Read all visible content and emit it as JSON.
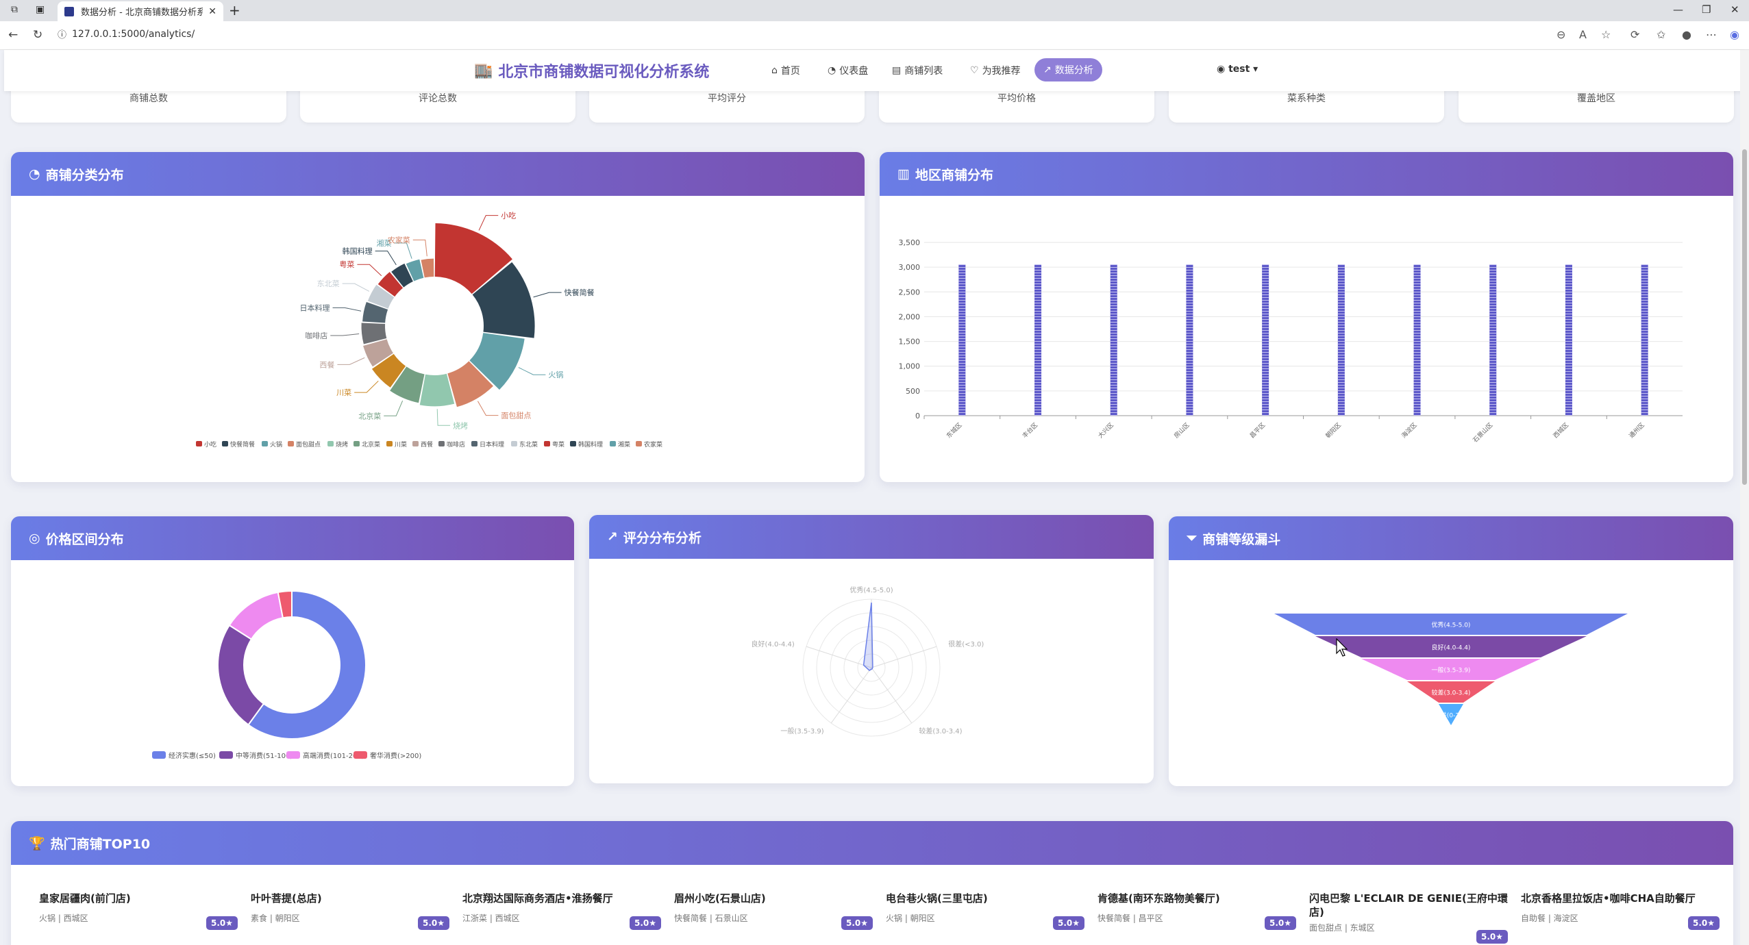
{
  "browser": {
    "tab_title": "数据分析 - 北京商铺数据分析系统",
    "url": "127.0.0.1:5000/analytics/"
  },
  "header": {
    "brand": "北京市商铺数据可视化分析系统",
    "nav": [
      "首页",
      "仪表盘",
      "商铺列表",
      "为我推荐",
      "数据分析"
    ],
    "user": "test"
  },
  "stats": [
    "商铺总数",
    "评论总数",
    "平均评分",
    "平均价格",
    "菜系种类",
    "覆盖地区"
  ],
  "panels": {
    "category": "商铺分类分布",
    "region": "地区商铺分布",
    "price": "价格区间分布",
    "rating": "评分分布分析",
    "funnel": "商铺等级漏斗",
    "top10": "热门商铺TOP10"
  },
  "chart_data": [
    {
      "type": "pie",
      "name": "category",
      "categories": [
        "小吃",
        "快餐简餐",
        "火锅",
        "面包甜点",
        "烧烤",
        "北京菜",
        "川菜",
        "西餐",
        "咖啡店",
        "日本料理",
        "东北菜",
        "粤菜",
        "韩国料理",
        "湘菜",
        "农家菜"
      ],
      "values": [
        100,
        95,
        75,
        60,
        52,
        48,
        42,
        38,
        36,
        34,
        32,
        30,
        28,
        26,
        24
      ],
      "colors": [
        "#c23531",
        "#2f4554",
        "#61a0a8",
        "#d48265",
        "#91c7ae",
        "#749f83",
        "#ca8622",
        "#bda29a",
        "#6e7074",
        "#546570",
        "#c4ccd3",
        "#c23531",
        "#2f4554",
        "#61a0a8",
        "#d48265"
      ]
    },
    {
      "type": "bar",
      "name": "region",
      "categories": [
        "东城区",
        "丰台区",
        "大兴区",
        "房山区",
        "昌平区",
        "朝阳区",
        "海淀区",
        "石景山区",
        "西城区",
        "通州区"
      ],
      "values": [
        3050,
        3050,
        3050,
        3050,
        3050,
        3050,
        3050,
        3050,
        3050,
        3050
      ],
      "ylim": [
        0,
        3500
      ],
      "yticks": [
        "0",
        "500",
        "1,000",
        "1,500",
        "2,000",
        "2,500",
        "3,000",
        "3,500"
      ]
    },
    {
      "type": "pie",
      "name": "price",
      "categories": [
        "经济实惠(≤50)",
        "中等消费(51-100)",
        "高端消费(101-200)",
        "奢华消费(>200)"
      ],
      "values": [
        60,
        24,
        13,
        3
      ],
      "colors": [
        "#6b80e8",
        "#7b4aa6",
        "#ee8af0",
        "#ee5a6e"
      ]
    },
    {
      "type": "radar",
      "name": "rating",
      "categories": [
        "优秀(4.5-5.0)",
        "很差(<3.0)",
        "较差(3.0-3.4)",
        "一般(3.5-3.9)",
        "良好(4.0-4.4)"
      ],
      "values": [
        0.95,
        0.02,
        0.02,
        0.05,
        0.12
      ]
    },
    {
      "type": "funnel",
      "name": "funnel",
      "categories": [
        "优秀(4.5-5.0)",
        "良好(4.0-4.4)",
        "一般(3.5-3.9)",
        "较差(3.0-3.4)",
        "很差(0-2.9)"
      ],
      "colors": [
        "#6b80e8",
        "#7b4aa6",
        "#ee8af0",
        "#ee5a6e",
        "#4facfe"
      ]
    }
  ],
  "top10": [
    {
      "name": "皇家居疆肉(前门店)",
      "meta": "火锅 | 西城区",
      "score": "5.0★"
    },
    {
      "name": "叶叶菩提(总店)",
      "meta": "素食 | 朝阳区",
      "score": "5.0★"
    },
    {
      "name": "北京翔达国际商务酒店•淮扬餐厅",
      "meta": "江浙菜 | 西城区",
      "score": "5.0★"
    },
    {
      "name": "眉州小吃(石景山店)",
      "meta": "快餐简餐 | 石景山区",
      "score": "5.0★"
    },
    {
      "name": "电台巷火锅(三里屯店)",
      "meta": "火锅 | 朝阳区",
      "score": "5.0★"
    },
    {
      "name": "肯德基(南环东路物美餐厅)",
      "meta": "快餐简餐 | 昌平区",
      "score": "5.0★"
    },
    {
      "name": "闪电巴黎 L'ECLAIR DE GENIE(王府中環店)",
      "meta": "面包甜点 | 东城区",
      "score": "5.0★"
    },
    {
      "name": "北京香格里拉饭店•咖啡CHA自助餐厅",
      "meta": "自助餐 | 海淀区",
      "score": "5.0★"
    }
  ]
}
